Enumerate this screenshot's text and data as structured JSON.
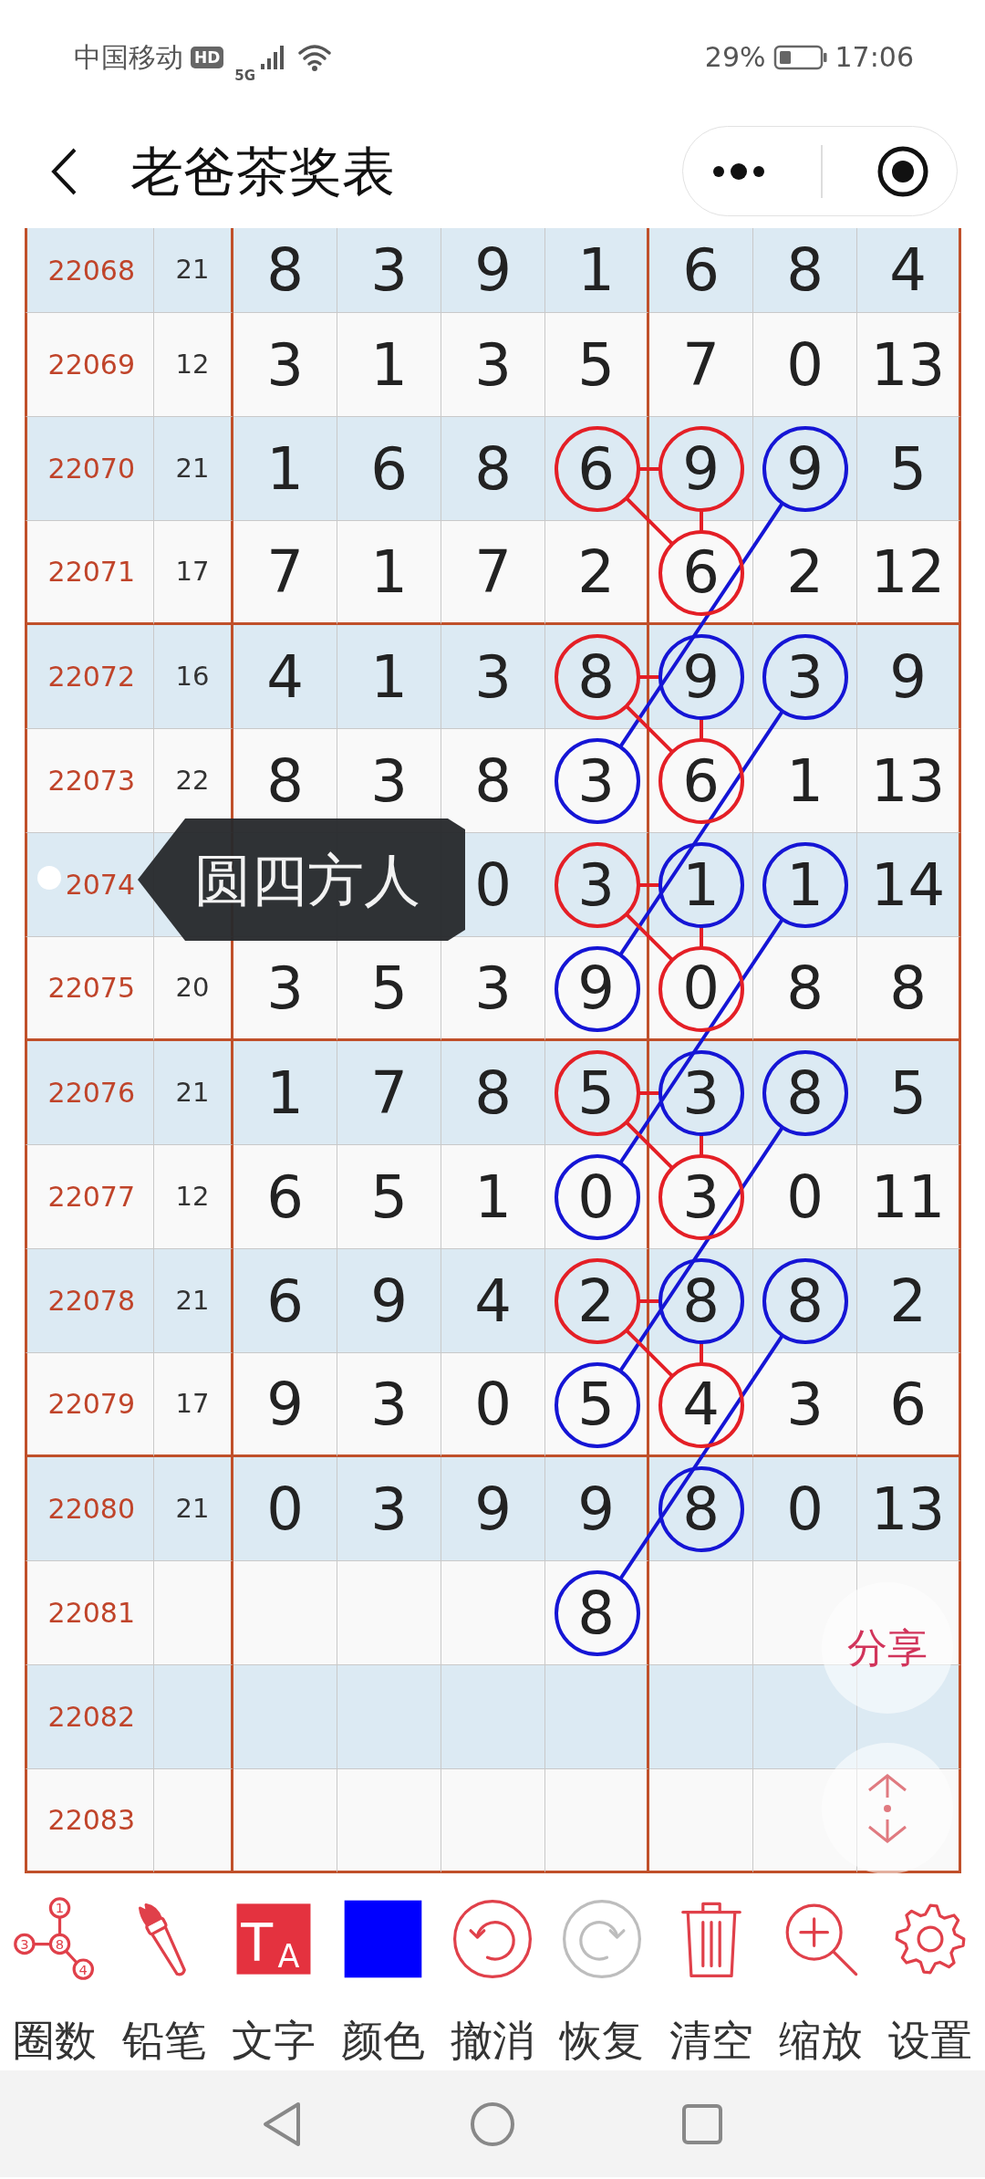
{
  "status_bar": {
    "carrier": "中国移动",
    "hd_badge": "HD",
    "network": "5G",
    "battery": "29%",
    "time": "17:06"
  },
  "header": {
    "title": "老爸茶奖表"
  },
  "rows": [
    {
      "issue": "22068",
      "sum": "21",
      "cells": [
        {
          "text": "8"
        },
        {
          "text": "3"
        },
        {
          "text": "9"
        },
        {
          "text": "1"
        },
        {
          "text": "6"
        },
        {
          "text": "8"
        },
        {
          "text": "4"
        }
      ]
    },
    {
      "issue": "22069",
      "sum": "12",
      "cells": [
        {
          "text": "3"
        },
        {
          "text": "1"
        },
        {
          "text": "3"
        },
        {
          "text": "5"
        },
        {
          "text": "7"
        },
        {
          "text": "0"
        },
        {
          "text": "13"
        }
      ]
    },
    {
      "issue": "22070",
      "sum": "21",
      "cells": [
        {
          "text": "1"
        },
        {
          "text": "6"
        },
        {
          "text": "8"
        },
        {
          "text": "6",
          "color": "#e41f26",
          "lines": [
            {
              "kind": "right"
            },
            {
              "kind": "down-right"
            }
          ]
        },
        {
          "text": "9",
          "color": "#e41f26"
        },
        {
          "text": "9",
          "color": "#1515d5",
          "lines": [
            {
              "kind": "steep-down-left"
            }
          ]
        },
        {
          "text": "5"
        }
      ]
    },
    {
      "issue": "22071",
      "sum": "17",
      "cells": [
        {
          "text": "7"
        },
        {
          "text": "1"
        },
        {
          "text": "7"
        },
        {
          "text": "2"
        },
        {
          "text": "6",
          "color": "#e41f26",
          "lines": [
            {
              "kind": "up"
            }
          ]
        },
        {
          "text": "2"
        },
        {
          "text": "12"
        }
      ]
    },
    {
      "issue": "22072",
      "sum": "16",
      "cells": [
        {
          "text": "4"
        },
        {
          "text": "1"
        },
        {
          "text": "3"
        },
        {
          "text": "8",
          "color": "#e41f26",
          "lines": [
            {
              "kind": "right"
            },
            {
              "kind": "down-right"
            }
          ]
        },
        {
          "text": "9",
          "color": "#1515d5"
        },
        {
          "text": "3",
          "color": "#1515d5",
          "lines": [
            {
              "kind": "steep-down-left"
            }
          ]
        },
        {
          "text": "9"
        }
      ]
    },
    {
      "issue": "22073",
      "sum": "22",
      "cells": [
        {
          "text": "8"
        },
        {
          "text": "3"
        },
        {
          "text": "8"
        },
        {
          "text": "3",
          "color": "#1515d5"
        },
        {
          "text": "6",
          "color": "#e41f26",
          "lines": [
            {
              "kind": "up"
            }
          ]
        },
        {
          "text": "1"
        },
        {
          "text": "13"
        }
      ]
    },
    {
      "issue": "2074",
      "cells": [
        null,
        null,
        {
          "text": "0"
        },
        {
          "text": "3",
          "color": "#e41f26",
          "lines": [
            {
              "kind": "right"
            },
            {
              "kind": "down-right"
            }
          ]
        },
        {
          "text": "1",
          "color": "#1515d5"
        },
        {
          "text": "1",
          "color": "#1515d5",
          "lines": [
            {
              "kind": "steep-down-left"
            }
          ]
        },
        {
          "text": "14"
        }
      ]
    },
    {
      "issue": "22075",
      "sum": "20",
      "cells": [
        {
          "text": "3"
        },
        {
          "text": "5"
        },
        {
          "text": "3"
        },
        {
          "text": "9",
          "color": "#1515d5"
        },
        {
          "text": "0",
          "color": "#e41f26",
          "lines": [
            {
              "kind": "up"
            }
          ]
        },
        {
          "text": "8"
        },
        {
          "text": "8"
        }
      ]
    },
    {
      "issue": "22076",
      "sum": "21",
      "cells": [
        {
          "text": "1"
        },
        {
          "text": "7"
        },
        {
          "text": "8"
        },
        {
          "text": "5",
          "color": "#e41f26",
          "lines": [
            {
              "kind": "right"
            },
            {
              "kind": "down-right"
            }
          ]
        },
        {
          "text": "3",
          "color": "#1515d5"
        },
        {
          "text": "8",
          "color": "#1515d5",
          "lines": [
            {
              "kind": "steep-down-left"
            }
          ]
        },
        {
          "text": "5"
        }
      ]
    },
    {
      "issue": "22077",
      "sum": "12",
      "cells": [
        {
          "text": "6"
        },
        {
          "text": "5"
        },
        {
          "text": "1"
        },
        {
          "text": "0",
          "color": "#1515d5"
        },
        {
          "text": "3",
          "color": "#e41f26",
          "lines": [
            {
              "kind": "up"
            }
          ]
        },
        {
          "text": "0"
        },
        {
          "text": "11"
        }
      ]
    },
    {
      "issue": "22078",
      "sum": "21",
      "cells": [
        {
          "text": "6"
        },
        {
          "text": "9"
        },
        {
          "text": "4"
        },
        {
          "text": "2",
          "color": "#e41f26",
          "lines": [
            {
              "kind": "right"
            },
            {
              "kind": "down-right"
            }
          ]
        },
        {
          "text": "8",
          "color": "#1515d5"
        },
        {
          "text": "8",
          "color": "#1515d5",
          "lines": [
            {
              "kind": "steep-down-left"
            }
          ]
        },
        {
          "text": "2"
        }
      ]
    },
    {
      "issue": "22079",
      "sum": "17",
      "cells": [
        {
          "text": "9"
        },
        {
          "text": "3"
        },
        {
          "text": "0"
        },
        {
          "text": "5",
          "color": "#1515d5"
        },
        {
          "text": "4",
          "color": "#e41f26",
          "lines": [
            {
              "kind": "up"
            }
          ]
        },
        {
          "text": "3"
        },
        {
          "text": "6"
        }
      ]
    },
    {
      "issue": "22080",
      "sum": "21",
      "cells": [
        {
          "text": "0"
        },
        {
          "text": "3"
        },
        {
          "text": "9"
        },
        {
          "text": "9"
        },
        {
          "text": "8",
          "color": "#1515d5"
        },
        {
          "text": "0"
        },
        {
          "text": "13"
        }
      ]
    },
    {
      "issue": "22081",
      "cells": [
        null,
        null,
        null,
        {
          "text": "8",
          "color": "#1515d5"
        },
        null,
        null,
        null
      ]
    },
    {
      "issue": "22082"
    },
    {
      "issue": "22083"
    }
  ],
  "tooltip": {
    "text": "圆四方人"
  },
  "share_button": "分享",
  "toolbar": [
    {
      "kind": "circles",
      "label": "圈数",
      "icon_digits": [
        "1",
        "3",
        "8",
        "4"
      ],
      "disabled": false
    },
    {
      "kind": "pencil",
      "label": "铅笔",
      "disabled": false
    },
    {
      "kind": "text",
      "label": "文字",
      "icon_letters": [
        "T",
        "A"
      ],
      "disabled": false
    },
    {
      "kind": "color",
      "label": "颜色",
      "color": "#0000ff",
      "disabled": false
    },
    {
      "kind": "undo",
      "label": "撤消",
      "disabled": false
    },
    {
      "kind": "redo",
      "label": "恢复",
      "disabled": true
    },
    {
      "kind": "clear",
      "label": "清空",
      "disabled": false
    },
    {
      "kind": "zoom",
      "label": "缩放",
      "disabled": false
    },
    {
      "kind": "settings",
      "label": "设置",
      "disabled": false
    }
  ]
}
